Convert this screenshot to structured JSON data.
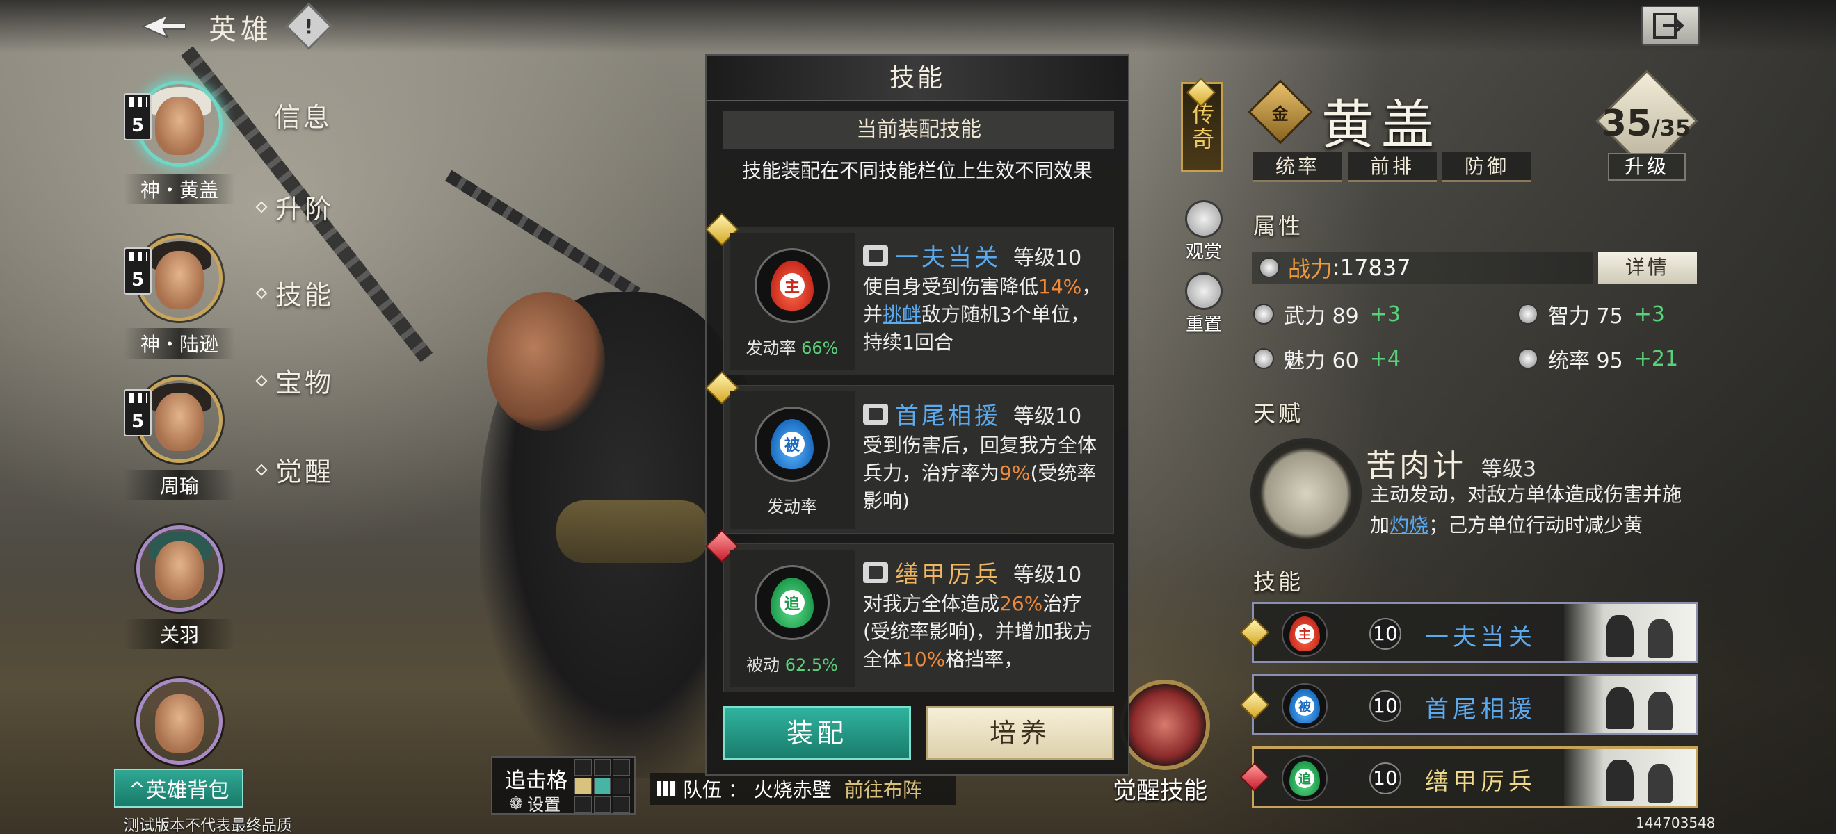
{
  "header": {
    "title": "英雄",
    "alert_glyph": "!"
  },
  "hero_list": [
    {
      "name": "神・黄盖",
      "rank": "5",
      "selected": true
    },
    {
      "name": "神・陆逊",
      "rank": "5",
      "selected": false
    },
    {
      "name": "周瑜",
      "rank": "5",
      "selected": false
    },
    {
      "name": "关羽",
      "rank": "",
      "selected": false
    },
    {
      "name": "",
      "rank": "",
      "selected": false
    }
  ],
  "side_nav": [
    "信息",
    "升阶",
    "技能",
    "宝物",
    "觉醒"
  ],
  "hero_bag_label": "^英雄背包",
  "footer_note": "测试版本不代表最终品质",
  "build_number": "144703548",
  "chase": {
    "label": "追击格",
    "settings": "设置"
  },
  "team": {
    "label": "队伍 ： 火烧赤壁",
    "goto": "前往布阵"
  },
  "awaken_label": "觉醒技能",
  "modal": {
    "title": "技能",
    "subtitle": "当前装配技能",
    "description": "技能装配在不同技能栏位上生效不同效果",
    "skills": [
      {
        "name": "一夫当关",
        "level": "等级10",
        "type_tag": "主",
        "trigger_label": "发动率",
        "trigger_value": "66%",
        "text_1": "使自身受到伤害降低",
        "hl_1": "14%",
        "text_2": "，并",
        "link_1": "挑衅",
        "text_3": "敌方随机3个单位，持续1回合"
      },
      {
        "name": "首尾相援",
        "level": "等级10",
        "type_tag": "被",
        "trigger_label": "发动率",
        "trigger_value": "",
        "text_1": "受到伤害后，回复我方全体兵力，治疗率为",
        "hl_1": "9%",
        "text_2": "(受统率影响)"
      },
      {
        "name": "缮甲厉兵",
        "level": "等级10",
        "type_tag": "追",
        "trigger_label": "被动",
        "trigger_value": "62.5%",
        "text_1": "对我方全体造成",
        "hl_1": "26%",
        "text_2": "治疗(受统率影响)，并增加我方全体",
        "hl_2": "10%",
        "text_3": "格挡率，"
      }
    ],
    "equip_label": "装配",
    "train_label": "培养"
  },
  "hero": {
    "quality": "传奇",
    "grade_glyph": "金",
    "name": "黄盖",
    "tags": [
      "统率",
      "前排",
      "防御"
    ],
    "level": "35",
    "level_max": "/35",
    "upgrade_label": "升级",
    "tools": [
      {
        "label": "观赏",
        "icon": "view-icon"
      },
      {
        "label": "重置",
        "icon": "reset-icon"
      }
    ],
    "attributes_title": "属性",
    "power_label": "战力",
    "power_value": ":17837",
    "detail_label": "详情",
    "stats": [
      {
        "label": "武力 89",
        "bonus": "+3"
      },
      {
        "label": "智力 75",
        "bonus": "+3"
      },
      {
        "label": "魅力 60",
        "bonus": "+4"
      },
      {
        "label": "统率 95",
        "bonus": "+21"
      }
    ],
    "talent_title": "天赋",
    "talent": {
      "name": "苦肉计",
      "level": "等级3",
      "desc_1": "主动发动，对敌方单体造成伤害并施加",
      "desc_link": "灼烧",
      "desc_2": "；己方单位行动时减少黄"
    },
    "skills_title": "技能",
    "skill_slots": [
      {
        "tag": "主",
        "level": "10",
        "name": "一夫当关",
        "color": "#5aaaf0"
      },
      {
        "tag": "被",
        "level": "10",
        "name": "首尾相援",
        "color": "#5aaaf0"
      },
      {
        "tag": "追",
        "level": "10",
        "name": "缮甲厉兵",
        "color": "#f0d98a"
      }
    ]
  },
  "colors": {
    "accent_teal": "#2fb39e",
    "orange_highlight": "#f08a3a",
    "blue_link": "#5aaaf0",
    "green_bonus": "#58d17a",
    "gold": "#c9a04a"
  }
}
